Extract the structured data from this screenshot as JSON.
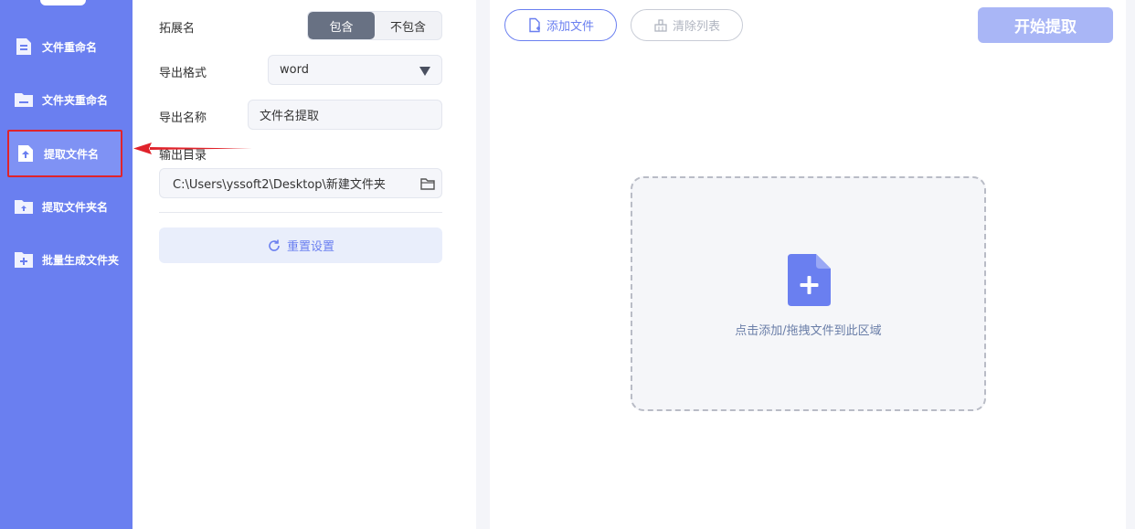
{
  "sidebar": {
    "items": [
      {
        "label": "文件重命名",
        "icon": "file-doc-icon"
      },
      {
        "label": "文件夹重命名",
        "icon": "folder-icon"
      },
      {
        "label": "提取文件名",
        "icon": "file-upload-icon",
        "active": true
      },
      {
        "label": "提取文件夹名",
        "icon": "folder-upload-icon"
      },
      {
        "label": "批量生成文件夹",
        "icon": "folder-add-icon"
      }
    ]
  },
  "settings": {
    "extension": {
      "label": "拓展名",
      "options": [
        "包含",
        "不包含"
      ],
      "selected": "包含"
    },
    "export_format": {
      "label": "导出格式",
      "value": "word"
    },
    "export_name": {
      "label": "导出名称",
      "value": "文件名提取"
    },
    "output_dir": {
      "label": "输出目录",
      "value": "C:\\Users\\yssoft2\\Desktop\\新建文件夹"
    },
    "reset_label": "重置设置"
  },
  "toolbar": {
    "add_label": "添加文件",
    "clear_label": "清除列表",
    "start_label": "开始提取"
  },
  "dropzone": {
    "text": "点击添加/拖拽文件到此区域"
  },
  "colors": {
    "sidebar": "#6a7ff0",
    "accent": "#6a7ff0",
    "highlight_border": "#e0232b",
    "start_button": "#a9b6f6"
  }
}
